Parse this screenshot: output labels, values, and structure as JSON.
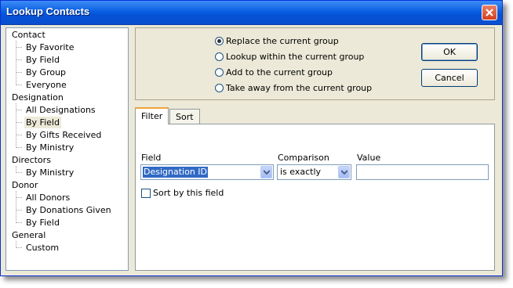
{
  "window": {
    "title": "Lookup Contacts"
  },
  "tree": {
    "groups": [
      {
        "label": "Contact",
        "children": [
          "By Favorite",
          "By Field",
          "By Group",
          "Everyone"
        ]
      },
      {
        "label": "Designation",
        "children": [
          "All Designations",
          "By Field",
          "By Gifts Received",
          "By Ministry"
        ]
      },
      {
        "label": "Directors",
        "children": [
          "By Ministry"
        ]
      },
      {
        "label": "Donor",
        "children": [
          "All Donors",
          "By Donations Given",
          "By Field"
        ]
      },
      {
        "label": "General",
        "children": [
          "Custom"
        ]
      }
    ],
    "selected": "Designation / By Field"
  },
  "options": {
    "radios": [
      {
        "label": "Replace the current group",
        "checked": true
      },
      {
        "label": "Lookup within the current group",
        "checked": false
      },
      {
        "label": "Add to the current group",
        "checked": false
      },
      {
        "label": "Take away from the current group",
        "checked": false
      }
    ]
  },
  "buttons": {
    "ok": "OK",
    "cancel": "Cancel"
  },
  "tabs": [
    {
      "label": "Filter",
      "active": true
    },
    {
      "label": "Sort",
      "active": false
    }
  ],
  "filter": {
    "field_label": "Field",
    "field_value": "Designation ID",
    "comparison_label": "Comparison",
    "comparison_value": "is exactly",
    "value_label": "Value",
    "value_value": "",
    "sort_checkbox_label": "Sort by this field",
    "sort_checked": false
  }
}
